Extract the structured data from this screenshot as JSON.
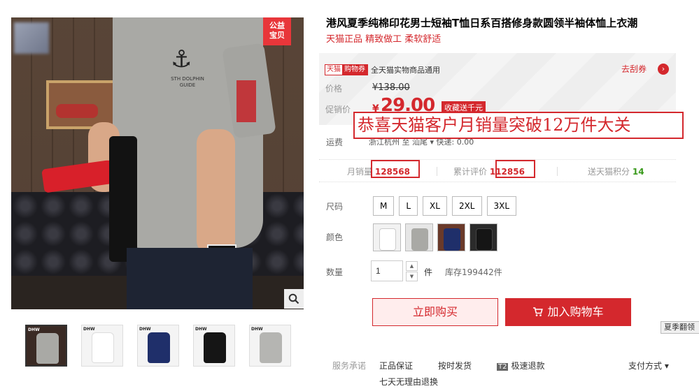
{
  "product": {
    "title": "港风夏季纯棉印花男士短袖T恤日系百搭修身款圆领半袖体恤上衣潮",
    "subtitle": "天猫正品 精致做工 柔软舒适",
    "charity_badge": "公益\n宝贝",
    "print_text": "STH DOLPHIN GUIDE"
  },
  "coupon": {
    "tag_left": "天猫",
    "tag_right": "购物券",
    "text": "全天猫实物商品通用",
    "action": "去刮券"
  },
  "price": {
    "orig_label": "价格",
    "orig_value": "¥138.00",
    "promo_label": "促销价",
    "currency": "¥",
    "promo_value": "29.00",
    "fav_tag": "收藏送千元"
  },
  "overlay_text": "恭喜天猫客户月销量突破12万件大关",
  "shipping": {
    "label": "运费",
    "value": "浙江杭州 至 汕尾 ▾  快递: 0.00"
  },
  "stats": {
    "monthly_label": "月销量",
    "monthly_value": "128568",
    "reviews_label": "累计评价",
    "reviews_value": "112856",
    "points_label": "送天猫积分",
    "points_value": "14"
  },
  "options": {
    "size_label": "尺码",
    "sizes": [
      "M",
      "L",
      "XL",
      "2XL",
      "3XL"
    ],
    "color_label": "颜色",
    "qty_label": "数量",
    "qty_value": "1",
    "qty_unit": "件",
    "stock": "库存199442件"
  },
  "actions": {
    "buy_now": "立即购买",
    "add_cart": "加入购物车"
  },
  "side_tab": "夏季翻领",
  "promise": {
    "label": "服务承诺",
    "items": [
      "正品保证",
      "按时发货",
      "极速退款",
      "七天无理由退换"
    ],
    "t2": "T2",
    "pay": "支付方式 ▾"
  },
  "colors": {
    "accent": "#d4282d",
    "shirt_grey": "#a9a9a5",
    "shirt_white": "#f2f2f2",
    "shirt_navy": "#1f2f6a",
    "shirt_black": "#151515"
  }
}
